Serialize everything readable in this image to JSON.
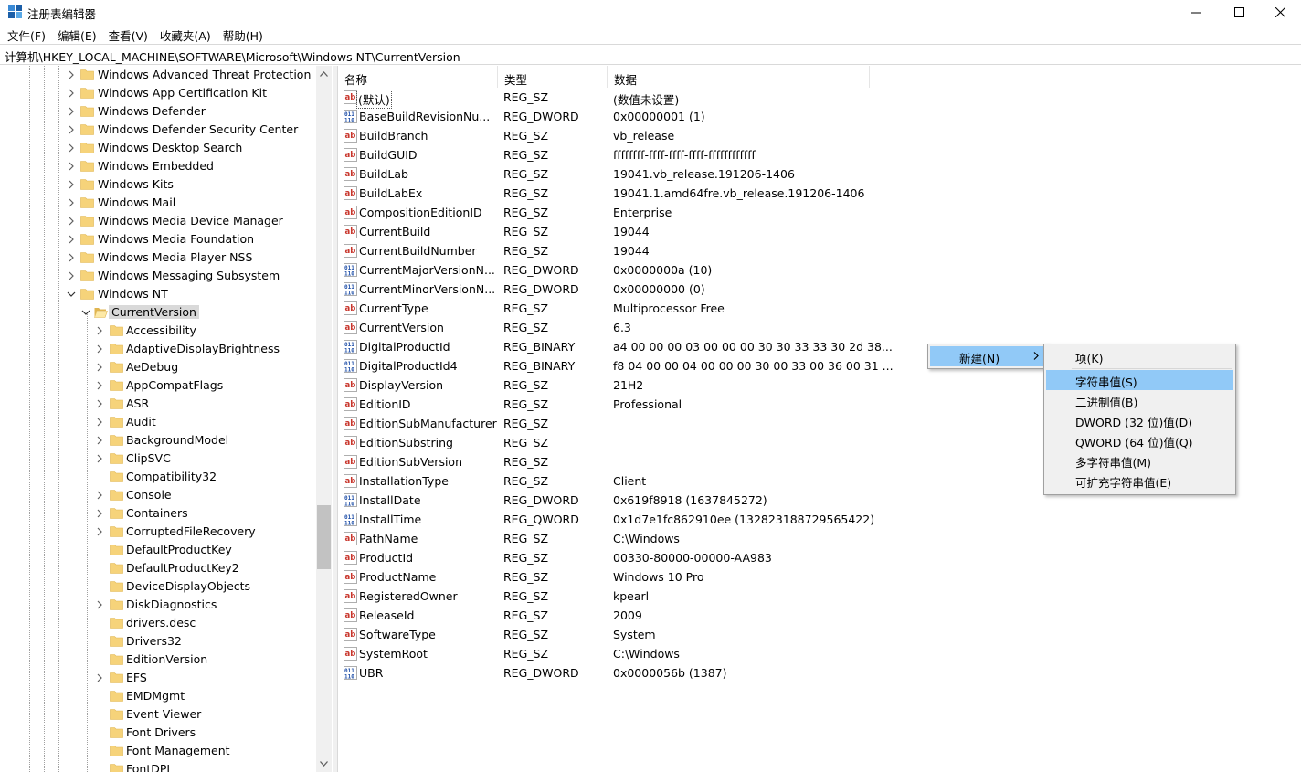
{
  "window": {
    "title": "注册表编辑器"
  },
  "menubar": [
    "文件(F)",
    "编辑(E)",
    "查看(V)",
    "收藏夹(A)",
    "帮助(H)"
  ],
  "address": "计算机\\HKEY_LOCAL_MACHINE\\SOFTWARE\\Microsoft\\Windows NT\\CurrentVersion",
  "tree": {
    "items": [
      {
        "label": "Windows Advanced Threat Protection",
        "level": 0,
        "state": "collapsed"
      },
      {
        "label": "Windows App Certification Kit",
        "level": 0,
        "state": "collapsed"
      },
      {
        "label": "Windows Defender",
        "level": 0,
        "state": "collapsed"
      },
      {
        "label": "Windows Defender Security Center",
        "level": 0,
        "state": "collapsed"
      },
      {
        "label": "Windows Desktop Search",
        "level": 0,
        "state": "collapsed"
      },
      {
        "label": "Windows Embedded",
        "level": 0,
        "state": "collapsed"
      },
      {
        "label": "Windows Kits",
        "level": 0,
        "state": "collapsed"
      },
      {
        "label": "Windows Mail",
        "level": 0,
        "state": "collapsed"
      },
      {
        "label": "Windows Media Device Manager",
        "level": 0,
        "state": "collapsed"
      },
      {
        "label": "Windows Media Foundation",
        "level": 0,
        "state": "collapsed"
      },
      {
        "label": "Windows Media Player NSS",
        "level": 0,
        "state": "collapsed"
      },
      {
        "label": "Windows Messaging Subsystem",
        "level": 0,
        "state": "collapsed"
      },
      {
        "label": "Windows NT",
        "level": 0,
        "state": "expanded"
      },
      {
        "label": "CurrentVersion",
        "level": 1,
        "state": "expanded",
        "selected": true
      },
      {
        "label": "Accessibility",
        "level": 2,
        "state": "collapsed"
      },
      {
        "label": "AdaptiveDisplayBrightness",
        "level": 2,
        "state": "collapsed"
      },
      {
        "label": "AeDebug",
        "level": 2,
        "state": "collapsed"
      },
      {
        "label": "AppCompatFlags",
        "level": 2,
        "state": "collapsed"
      },
      {
        "label": "ASR",
        "level": 2,
        "state": "collapsed"
      },
      {
        "label": "Audit",
        "level": 2,
        "state": "collapsed"
      },
      {
        "label": "BackgroundModel",
        "level": 2,
        "state": "collapsed"
      },
      {
        "label": "ClipSVC",
        "level": 2,
        "state": "collapsed"
      },
      {
        "label": "Compatibility32",
        "level": 2,
        "state": "leaf"
      },
      {
        "label": "Console",
        "level": 2,
        "state": "collapsed"
      },
      {
        "label": "Containers",
        "level": 2,
        "state": "collapsed"
      },
      {
        "label": "CorruptedFileRecovery",
        "level": 2,
        "state": "collapsed"
      },
      {
        "label": "DefaultProductKey",
        "level": 2,
        "state": "leaf"
      },
      {
        "label": "DefaultProductKey2",
        "level": 2,
        "state": "leaf"
      },
      {
        "label": "DeviceDisplayObjects",
        "level": 2,
        "state": "leaf"
      },
      {
        "label": "DiskDiagnostics",
        "level": 2,
        "state": "collapsed"
      },
      {
        "label": "drivers.desc",
        "level": 2,
        "state": "leaf"
      },
      {
        "label": "Drivers32",
        "level": 2,
        "state": "leaf"
      },
      {
        "label": "EditionVersion",
        "level": 2,
        "state": "leaf"
      },
      {
        "label": "EFS",
        "level": 2,
        "state": "collapsed"
      },
      {
        "label": "EMDMgmt",
        "level": 2,
        "state": "leaf"
      },
      {
        "label": "Event Viewer",
        "level": 2,
        "state": "leaf"
      },
      {
        "label": "Font Drivers",
        "level": 2,
        "state": "leaf"
      },
      {
        "label": "Font Management",
        "level": 2,
        "state": "leaf"
      },
      {
        "label": "FontDPI",
        "level": 2,
        "state": "leaf"
      }
    ]
  },
  "columns": {
    "name": "名称",
    "type": "类型",
    "data": "数据"
  },
  "values": [
    {
      "name": "(默认)",
      "type": "REG_SZ",
      "data": "(数值未设置)",
      "icon": "ab"
    },
    {
      "name": "BaseBuildRevisionNumber",
      "type": "REG_DWORD",
      "data": "0x00000001 (1)",
      "icon": "bin"
    },
    {
      "name": "BuildBranch",
      "type": "REG_SZ",
      "data": "vb_release",
      "icon": "ab"
    },
    {
      "name": "BuildGUID",
      "type": "REG_SZ",
      "data": "ffffffff-ffff-ffff-ffff-ffffffffffff",
      "icon": "ab"
    },
    {
      "name": "BuildLab",
      "type": "REG_SZ",
      "data": "19041.vb_release.191206-1406",
      "icon": "ab"
    },
    {
      "name": "BuildLabEx",
      "type": "REG_SZ",
      "data": "19041.1.amd64fre.vb_release.191206-1406",
      "icon": "ab"
    },
    {
      "name": "CompositionEditionID",
      "type": "REG_SZ",
      "data": "Enterprise",
      "icon": "ab"
    },
    {
      "name": "CurrentBuild",
      "type": "REG_SZ",
      "data": "19044",
      "icon": "ab"
    },
    {
      "name": "CurrentBuildNumber",
      "type": "REG_SZ",
      "data": "19044",
      "icon": "ab"
    },
    {
      "name": "CurrentMajorVersionNumber",
      "type": "REG_DWORD",
      "data": "0x0000000a (10)",
      "icon": "bin"
    },
    {
      "name": "CurrentMinorVersionNumber",
      "type": "REG_DWORD",
      "data": "0x00000000 (0)",
      "icon": "bin"
    },
    {
      "name": "CurrentType",
      "type": "REG_SZ",
      "data": "Multiprocessor Free",
      "icon": "ab"
    },
    {
      "name": "CurrentVersion",
      "type": "REG_SZ",
      "data": "6.3",
      "icon": "ab"
    },
    {
      "name": "DigitalProductId",
      "type": "REG_BINARY",
      "data": "a4 00 00 00 03 00 00 00 30 30 33 33 30 2d 38...",
      "icon": "bin"
    },
    {
      "name": "DigitalProductId4",
      "type": "REG_BINARY",
      "data": "f8 04 00 00 04 00 00 00 30 00 33 00 36 00 31 ...",
      "icon": "bin"
    },
    {
      "name": "DisplayVersion",
      "type": "REG_SZ",
      "data": "21H2",
      "icon": "ab"
    },
    {
      "name": "EditionID",
      "type": "REG_SZ",
      "data": "Professional",
      "icon": "ab"
    },
    {
      "name": "EditionSubManufacturer",
      "type": "REG_SZ",
      "data": "",
      "icon": "ab"
    },
    {
      "name": "EditionSubstring",
      "type": "REG_SZ",
      "data": "",
      "icon": "ab"
    },
    {
      "name": "EditionSubVersion",
      "type": "REG_SZ",
      "data": "",
      "icon": "ab"
    },
    {
      "name": "InstallationType",
      "type": "REG_SZ",
      "data": "Client",
      "icon": "ab"
    },
    {
      "name": "InstallDate",
      "type": "REG_DWORD",
      "data": "0x619f8918 (1637845272)",
      "icon": "bin"
    },
    {
      "name": "InstallTime",
      "type": "REG_QWORD",
      "data": "0x1d7e1fc862910ee (132823188729565422)",
      "icon": "bin"
    },
    {
      "name": "PathName",
      "type": "REG_SZ",
      "data": "C:\\Windows",
      "icon": "ab"
    },
    {
      "name": "ProductId",
      "type": "REG_SZ",
      "data": "00330-80000-00000-AA983",
      "icon": "ab"
    },
    {
      "name": "ProductName",
      "type": "REG_SZ",
      "data": "Windows 10 Pro",
      "icon": "ab"
    },
    {
      "name": "RegisteredOwner",
      "type": "REG_SZ",
      "data": "kpearl",
      "icon": "ab"
    },
    {
      "name": "ReleaseId",
      "type": "REG_SZ",
      "data": "2009",
      "icon": "ab"
    },
    {
      "name": "SoftwareType",
      "type": "REG_SZ",
      "data": "System",
      "icon": "ab"
    },
    {
      "name": "SystemRoot",
      "type": "REG_SZ",
      "data": "C:\\Windows",
      "icon": "ab"
    },
    {
      "name": "UBR",
      "type": "REG_DWORD",
      "data": "0x0000056b (1387)",
      "icon": "bin"
    }
  ],
  "context_menu": {
    "main_item": "新建(N)",
    "submenu": [
      {
        "label": "项(K)",
        "hover": false
      },
      {
        "label": "字符串值(S)",
        "hover": true
      },
      {
        "label": "二进制值(B)",
        "hover": false
      },
      {
        "label": "DWORD (32 位)值(D)",
        "hover": false
      },
      {
        "label": "QWORD (64 位)值(Q)",
        "hover": false
      },
      {
        "label": "多字符串值(M)",
        "hover": false
      },
      {
        "label": "可扩充字符串值(E)",
        "hover": false
      }
    ]
  },
  "colors": {
    "folder": "#f6d37a",
    "folder_dark": "#e0b550",
    "ab_red": "#c8352b",
    "bin_blue": "#1f4fa8",
    "highlight": "#91c9f7",
    "selection": "#d9d9d9"
  }
}
